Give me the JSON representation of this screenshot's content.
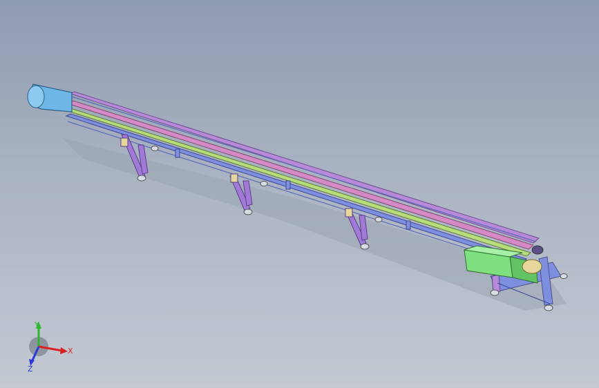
{
  "viewport": {
    "background_top": "#8e9bb0",
    "background_bottom": "#c4c9d2"
  },
  "model": {
    "description_hidden": "",
    "colors": {
      "hood": "#6fb7e6",
      "frame_blue": "#7f8fe0",
      "frame_purple": "#b889d8",
      "rail_pink": "#d58ac5",
      "rail_green": "#b7dd7b",
      "leg": "#a07ad6",
      "motor": "#7fe07f",
      "foot": "#d8dde5",
      "bracket": "#e6d79a"
    }
  },
  "triad": {
    "x_label": "X",
    "y_label": "Y",
    "z_label": "Z",
    "x_color": "#d92020",
    "y_color": "#2fb52f",
    "z_color": "#2a3ad8"
  }
}
